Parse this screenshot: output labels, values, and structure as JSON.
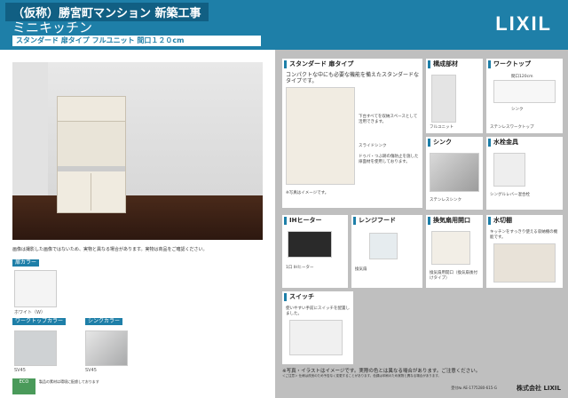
{
  "header": {
    "project": "（仮称）勝宮町マンション 新築工事",
    "title": "ミニキッチン",
    "spec": "スタンダード 扉タイプ フルユニット 間口１２０cm",
    "logo": "LIXIL"
  },
  "left": {
    "notes": "画像は撮影した画像ではないため、実物と異なる場合があります。実物は商品をご確認ください。",
    "door_color_label": "扉カラー",
    "door_caption": "ホワイト（W）",
    "worktop_color_label": "ワークトップカラー",
    "sink_color_label": "シンクカラー",
    "worktop_caption": "SV45",
    "sink_caption": "SV45",
    "eco_mark": "ECO",
    "eco_text": "製品の素材は環境に配慮しております"
  },
  "cards": {
    "standard": {
      "title": "スタンダード 扉タイプ",
      "desc": "コンパクトな中にも必要な機能を備えたスタンダードなタイプです。",
      "note1": "下台すべてを収納スペースとして活用できます。",
      "note2": "スライドシンク",
      "note3": "ドゥバ・つぶ跡の傷防止を施した扉面材を使用しております。",
      "footer": "※写真はイメージです。"
    },
    "structure": {
      "title": "構成部材",
      "caption": "フルユニット"
    },
    "worktop": {
      "title": "ワークトップ",
      "caption1": "間口120cm",
      "caption2": "シンク",
      "caption3": "ステンレスワークトップ"
    },
    "sink": {
      "title": "シンク",
      "caption": "ステンレスシンク"
    },
    "faucet": {
      "title": "水栓金具",
      "caption": "シングルレバー混合栓"
    },
    "ih": {
      "title": "IHヒーター",
      "caption": "1口 IHヒーター"
    },
    "rangehood": {
      "title": "レンジフード",
      "caption": "換気扇"
    },
    "vent": {
      "title": "換気扇用開口",
      "caption": "換気扇用開口（換気扇後付けタイプ）"
    },
    "water": {
      "title": "水切棚",
      "caption": "キッチンをすっきり使える収納棚の機能です。"
    },
    "switch": {
      "title": "スイッチ",
      "caption": "使いやすい手前にスイッチを配置しました。"
    }
  },
  "footer": {
    "disclaimer": "※写真・イラストはイメージです。実際の色とは異なる場合があります。ご注意ください。",
    "notes": "＜ご注意＞ 仕様は改良のため予告なく変更することがあります。色調は印刷のため実物と異なる場合があります。",
    "code": "受付№ AE-1775280-615-G",
    "company": "株式会社 LIXIL"
  }
}
